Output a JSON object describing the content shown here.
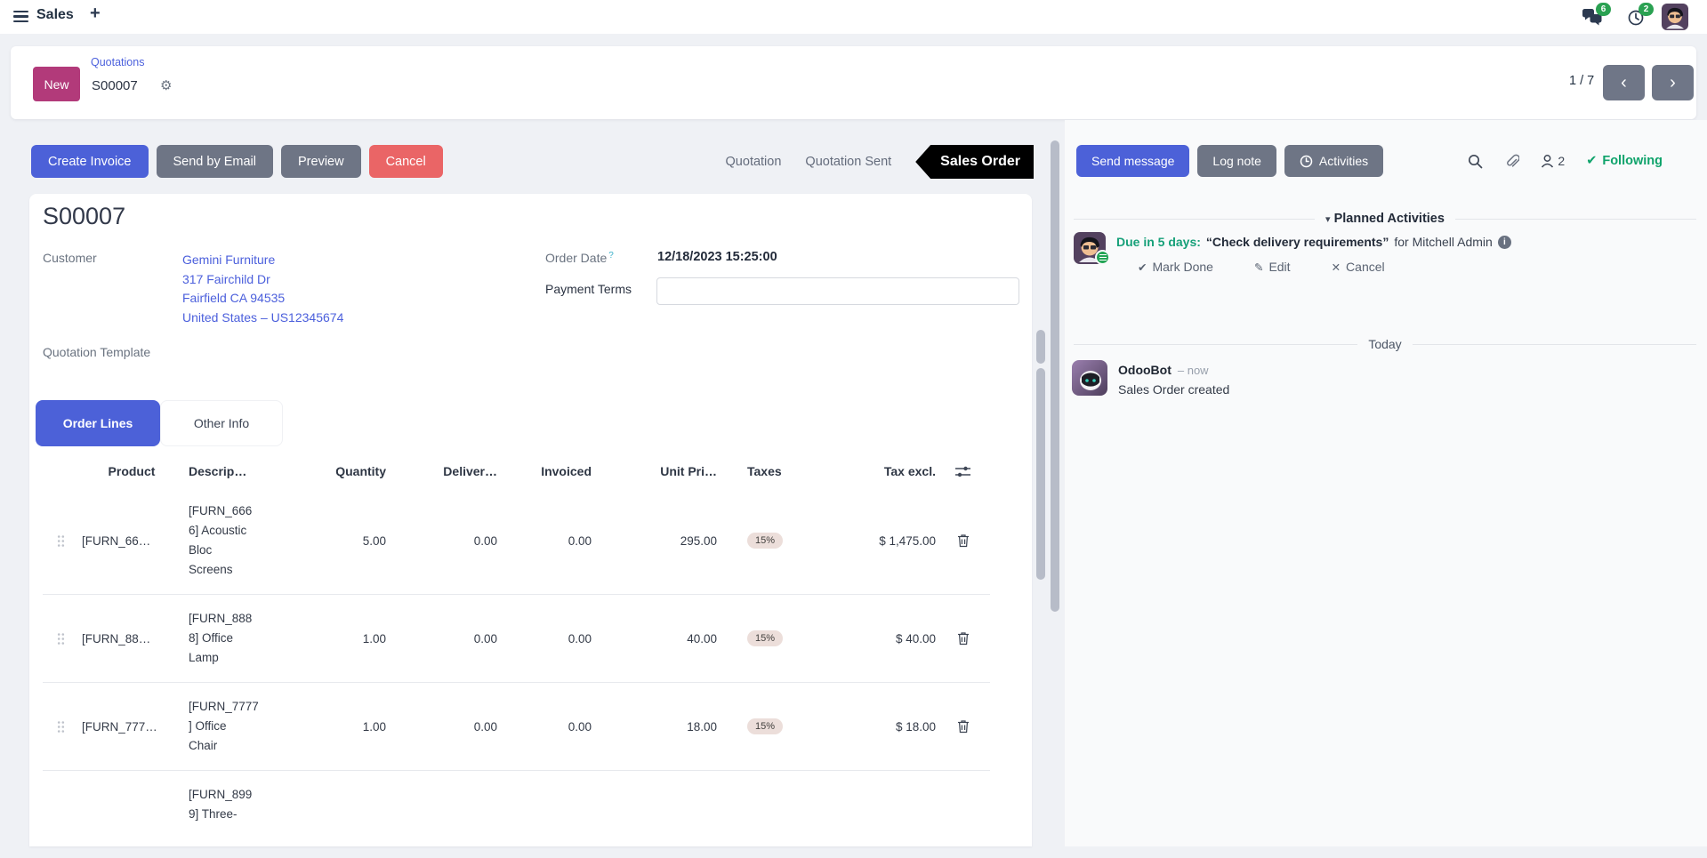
{
  "navbar": {
    "app_name": "Sales",
    "messages_badge": "6",
    "activities_badge": "2"
  },
  "breadcrumb": {
    "new_label": "New",
    "parent": "Quotations",
    "current": "S00007",
    "pager": "1 / 7"
  },
  "actions": {
    "create_invoice": "Create Invoice",
    "send_by_email": "Send by Email",
    "preview": "Preview",
    "cancel": "Cancel"
  },
  "stages": {
    "quotation": "Quotation",
    "quotation_sent": "Quotation Sent",
    "sales_order": "Sales Order"
  },
  "form": {
    "title": "S00007",
    "customer_label": "Customer",
    "customer_lines": [
      "Gemini Furniture",
      "317 Fairchild Dr",
      "Fairfield CA 94535",
      "United States – US12345674"
    ],
    "order_date_label": "Order Date",
    "order_date_help": "?",
    "order_date_value": "12/18/2023 15:25:00",
    "payment_terms_label": "Payment Terms",
    "payment_terms_value": "",
    "quotation_template_label": "Quotation Template",
    "tab_order_lines": "Order Lines",
    "tab_other_info": "Other Info"
  },
  "table": {
    "columns": [
      "Product",
      "Descrip…",
      "Quantity",
      "Deliver…",
      "Invoiced",
      "Unit Pri…",
      "Taxes",
      "Tax excl."
    ],
    "rows": [
      {
        "product": "[FURN_66…",
        "description": "[FURN_666\n6] Acoustic\nBloc\nScreens",
        "quantity": "5.00",
        "delivered": "0.00",
        "invoiced": "0.00",
        "unit_price": "295.00",
        "taxes": "15%",
        "tax_excl": "$ 1,475.00"
      },
      {
        "product": "[FURN_88…",
        "description": "[FURN_888\n8] Office\nLamp",
        "quantity": "1.00",
        "delivered": "0.00",
        "invoiced": "0.00",
        "unit_price": "40.00",
        "taxes": "15%",
        "tax_excl": "$ 40.00"
      },
      {
        "product": "[FURN_777…",
        "description": "[FURN_7777\n] Office\nChair",
        "quantity": "1.00",
        "delivered": "0.00",
        "invoiced": "0.00",
        "unit_price": "18.00",
        "taxes": "15%",
        "tax_excl": "$ 18.00"
      },
      {
        "product": "",
        "description": "[FURN_899\n9] Three-",
        "quantity": "",
        "delivered": "",
        "invoiced": "",
        "unit_price": "",
        "taxes": "",
        "tax_excl": ""
      }
    ]
  },
  "chatter": {
    "send_message": "Send message",
    "log_note": "Log note",
    "activities": "Activities",
    "followers_count": "2",
    "following": "Following",
    "planned_activities_title": "Planned Activities",
    "activity": {
      "due": "Due in 5 days:",
      "summary": "“Check delivery requirements”",
      "assignee": "for Mitchell Admin",
      "mark_done": "Mark Done",
      "edit": "Edit",
      "cancel": "Cancel"
    },
    "today_label": "Today",
    "message": {
      "author": "OdooBot",
      "time": "– now",
      "body": "Sales Order created"
    }
  },
  "colors": {
    "primary": "#4c61d8",
    "secondary": "#6e7585",
    "danger": "#ea6566",
    "new_button": "#b23a7a",
    "success_green": "#0fa36b",
    "stage_active_bg": "#000000",
    "tax_badge_bg": "#ecdeda"
  }
}
